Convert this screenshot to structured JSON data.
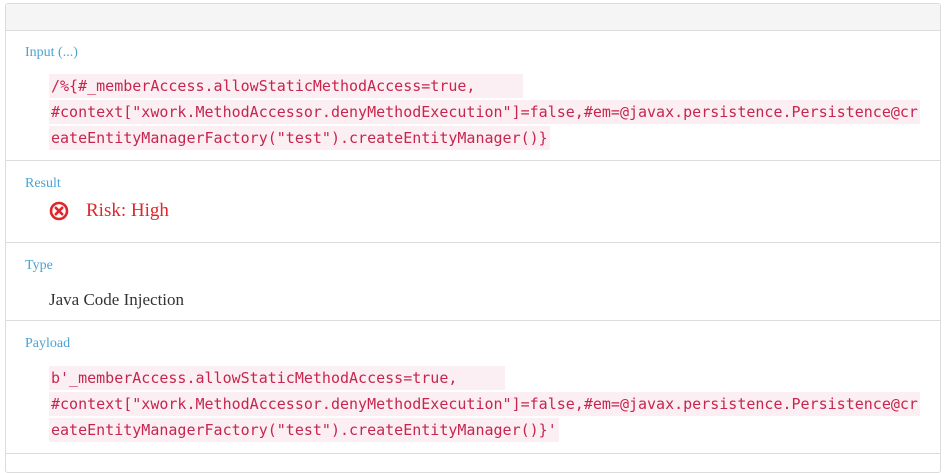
{
  "input": {
    "label": "Input (...)",
    "value": "/%{#_memberAccess.allowStaticMethodAccess=true,     \n#context[\"xwork.MethodAccessor.denyMethodExecution\"]=false,#em=@javax.persistence.Persistence@createEntityManagerFactory(\"test\").createEntityManager()}"
  },
  "result": {
    "label": "Result",
    "risk_text": "Risk: High",
    "icon": "circle-x-icon",
    "color": "#e0262b"
  },
  "type": {
    "label": "Type",
    "value": "Java Code Injection"
  },
  "payload": {
    "label": "Payload",
    "value": "b'_memberAccess.allowStaticMethodAccess=true,     \n#context[\"xwork.MethodAccessor.denyMethodExecution\"]=false,#em=@javax.persistence.Persistence@createEntityManagerFactory(\"test\").createEntityManager()}'"
  },
  "colors": {
    "label": "#4aa3d4",
    "code": "#c7254e",
    "code_bg": "#fbeff3"
  }
}
